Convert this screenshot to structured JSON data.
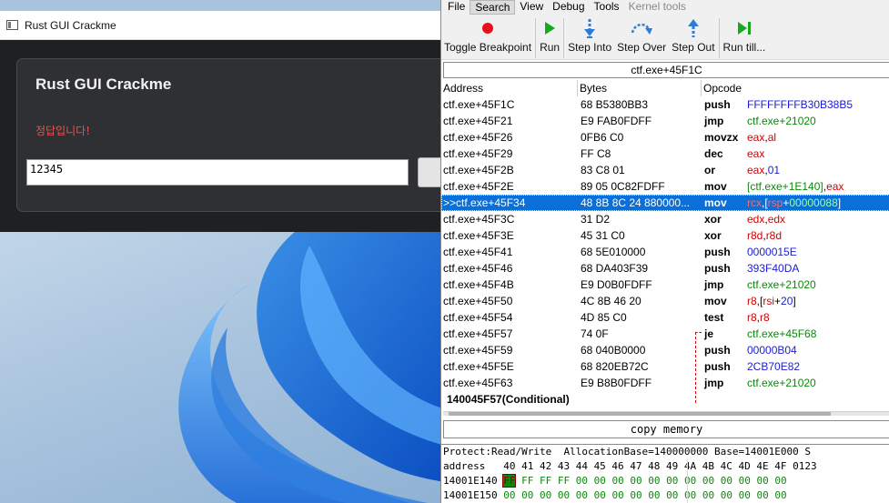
{
  "crackme": {
    "window_title": "Rust GUI Crackme",
    "heading": "Rust GUI Crackme",
    "message": "정답입니다!",
    "input_value": "12345"
  },
  "debugger": {
    "menu": [
      {
        "label": "File",
        "state": "normal"
      },
      {
        "label": "Search",
        "state": "active"
      },
      {
        "label": "View",
        "state": "normal"
      },
      {
        "label": "Debug",
        "state": "normal"
      },
      {
        "label": "Tools",
        "state": "normal"
      },
      {
        "label": "Kernel tools",
        "state": "disabled"
      }
    ],
    "toolbar": [
      {
        "label": "Toggle Breakpoint",
        "icon": "breakpoint-icon"
      },
      {
        "label": "Run",
        "icon": "run-icon"
      },
      {
        "label": "Step Into",
        "icon": "step-into-icon"
      },
      {
        "label": "Step Over",
        "icon": "step-over-icon"
      },
      {
        "label": "Step Out",
        "icon": "step-out-icon"
      },
      {
        "label": "Run till...",
        "icon": "run-till-icon"
      }
    ],
    "address_field": "ctf.exe+45F1C",
    "columns": {
      "address": "Address",
      "bytes": "Bytes",
      "opcode": "Opcode"
    },
    "rows": [
      {
        "addr": "ctf.exe+45F1C",
        "bytes": "68 B5380BB3",
        "mn": "push",
        "ops": [
          [
            "FFFFFFFFB30B38B5",
            "blue"
          ]
        ]
      },
      {
        "addr": "ctf.exe+45F21",
        "bytes": "E9 FAB0FDFF",
        "mn": "jmp",
        "ops": [
          [
            "ctf.exe+21020",
            "green"
          ]
        ]
      },
      {
        "addr": "ctf.exe+45F26",
        "bytes": "0FB6 C0",
        "mn": "movzx",
        "ops": [
          [
            " eax",
            "red"
          ],
          [
            ",",
            "dark"
          ],
          [
            "al",
            "red"
          ]
        ]
      },
      {
        "addr": "ctf.exe+45F29",
        "bytes": "FF C8",
        "mn": "dec",
        "ops": [
          [
            "eax",
            "red"
          ]
        ]
      },
      {
        "addr": "ctf.exe+45F2B",
        "bytes": "83 C8 01",
        "mn": "or",
        "ops": [
          [
            "eax",
            "red"
          ],
          [
            ",",
            "dark"
          ],
          [
            "01",
            "blue"
          ]
        ]
      },
      {
        "addr": "ctf.exe+45F2E",
        "bytes": "89 05 0C82FDFF",
        "mn": "mov",
        "ops": [
          [
            "[ctf.exe+1E140]",
            "green"
          ],
          [
            ",",
            "dark"
          ],
          [
            "eax",
            "red"
          ]
        ]
      },
      {
        "addr": ">>ctf.exe+45F34",
        "bytes": "48 8B 8C 24 880000...",
        "mn": "mov",
        "selected": true,
        "ops": [
          [
            "rcx",
            "red"
          ],
          [
            ",[",
            "dark"
          ],
          [
            "rsp",
            "red"
          ],
          [
            "+",
            "dark"
          ],
          [
            "00000088",
            "green"
          ],
          [
            "]",
            "dark"
          ]
        ]
      },
      {
        "addr": "ctf.exe+45F3C",
        "bytes": "31 D2",
        "mn": "xor",
        "ops": [
          [
            "edx",
            "red"
          ],
          [
            ",",
            "dark"
          ],
          [
            "edx",
            "red"
          ]
        ]
      },
      {
        "addr": "ctf.exe+45F3E",
        "bytes": "45 31 C0",
        "mn": "xor",
        "ops": [
          [
            "r8d",
            "red"
          ],
          [
            ",",
            "dark"
          ],
          [
            "r8d",
            "red"
          ]
        ]
      },
      {
        "addr": "ctf.exe+45F41",
        "bytes": "68 5E010000",
        "mn": "push",
        "ops": [
          [
            "0000015E",
            "blue"
          ]
        ]
      },
      {
        "addr": "ctf.exe+45F46",
        "bytes": "68 DA403F39",
        "mn": "push",
        "ops": [
          [
            "393F40DA",
            "blue"
          ]
        ]
      },
      {
        "addr": "ctf.exe+45F4B",
        "bytes": "E9 D0B0FDFF",
        "mn": "jmp",
        "ops": [
          [
            "ctf.exe+21020",
            "green"
          ]
        ]
      },
      {
        "addr": "ctf.exe+45F50",
        "bytes": "4C 8B 46 20",
        "mn": "mov",
        "ops": [
          [
            "r8",
            "red"
          ],
          [
            ",[",
            "dark"
          ],
          [
            "rsi",
            "red"
          ],
          [
            "+",
            "dark"
          ],
          [
            "20",
            "blue"
          ],
          [
            "]",
            "dark"
          ]
        ]
      },
      {
        "addr": "ctf.exe+45F54",
        "bytes": "4D 85 C0",
        "mn": "test",
        "ops": [
          [
            "r8",
            "red"
          ],
          [
            ",",
            "dark"
          ],
          [
            "r8",
            "red"
          ]
        ]
      },
      {
        "addr": "ctf.exe+45F57",
        "bytes": "74 0F",
        "mn": "je",
        "ops": [
          [
            "ctf.exe+45F68",
            "green"
          ]
        ]
      },
      {
        "addr": "ctf.exe+45F59",
        "bytes": "68 040B0000",
        "mn": "push",
        "ops": [
          [
            "00000B04",
            "blue"
          ]
        ]
      },
      {
        "addr": "ctf.exe+45F5E",
        "bytes": "68 820EB72C",
        "mn": "push",
        "ops": [
          [
            "2CB70E82",
            "blue"
          ]
        ]
      },
      {
        "addr": "ctf.exe+45F63",
        "bytes": "E9 B8B0FDFF",
        "mn": "jmp",
        "ops": [
          [
            "ctf.exe+21020",
            "green"
          ]
        ]
      }
    ],
    "conditional_label": "140045F57(Conditional)",
    "copy_memory": "copy memory",
    "hex": {
      "info_line": "Protect:Read/Write  AllocationBase=140000000 Base=14001E000 S",
      "header_line": "address   40 41 42 43 44 45 46 47 48 49 4A 4B 4C 4D 4E 4F 0123",
      "rows": [
        {
          "addr": "14001E140",
          "bytes": [
            "FF",
            "FF",
            "FF",
            "FF",
            "00",
            "00",
            "00",
            "00",
            "00",
            "00",
            "00",
            "00",
            "00",
            "00",
            "00",
            "00"
          ]
        },
        {
          "addr": "14001E150",
          "bytes": [
            "00",
            "00",
            "00",
            "00",
            "00",
            "00",
            "00",
            "00",
            "00",
            "00",
            "00",
            "00",
            "00",
            "00",
            "00",
            "00"
          ]
        }
      ]
    }
  }
}
